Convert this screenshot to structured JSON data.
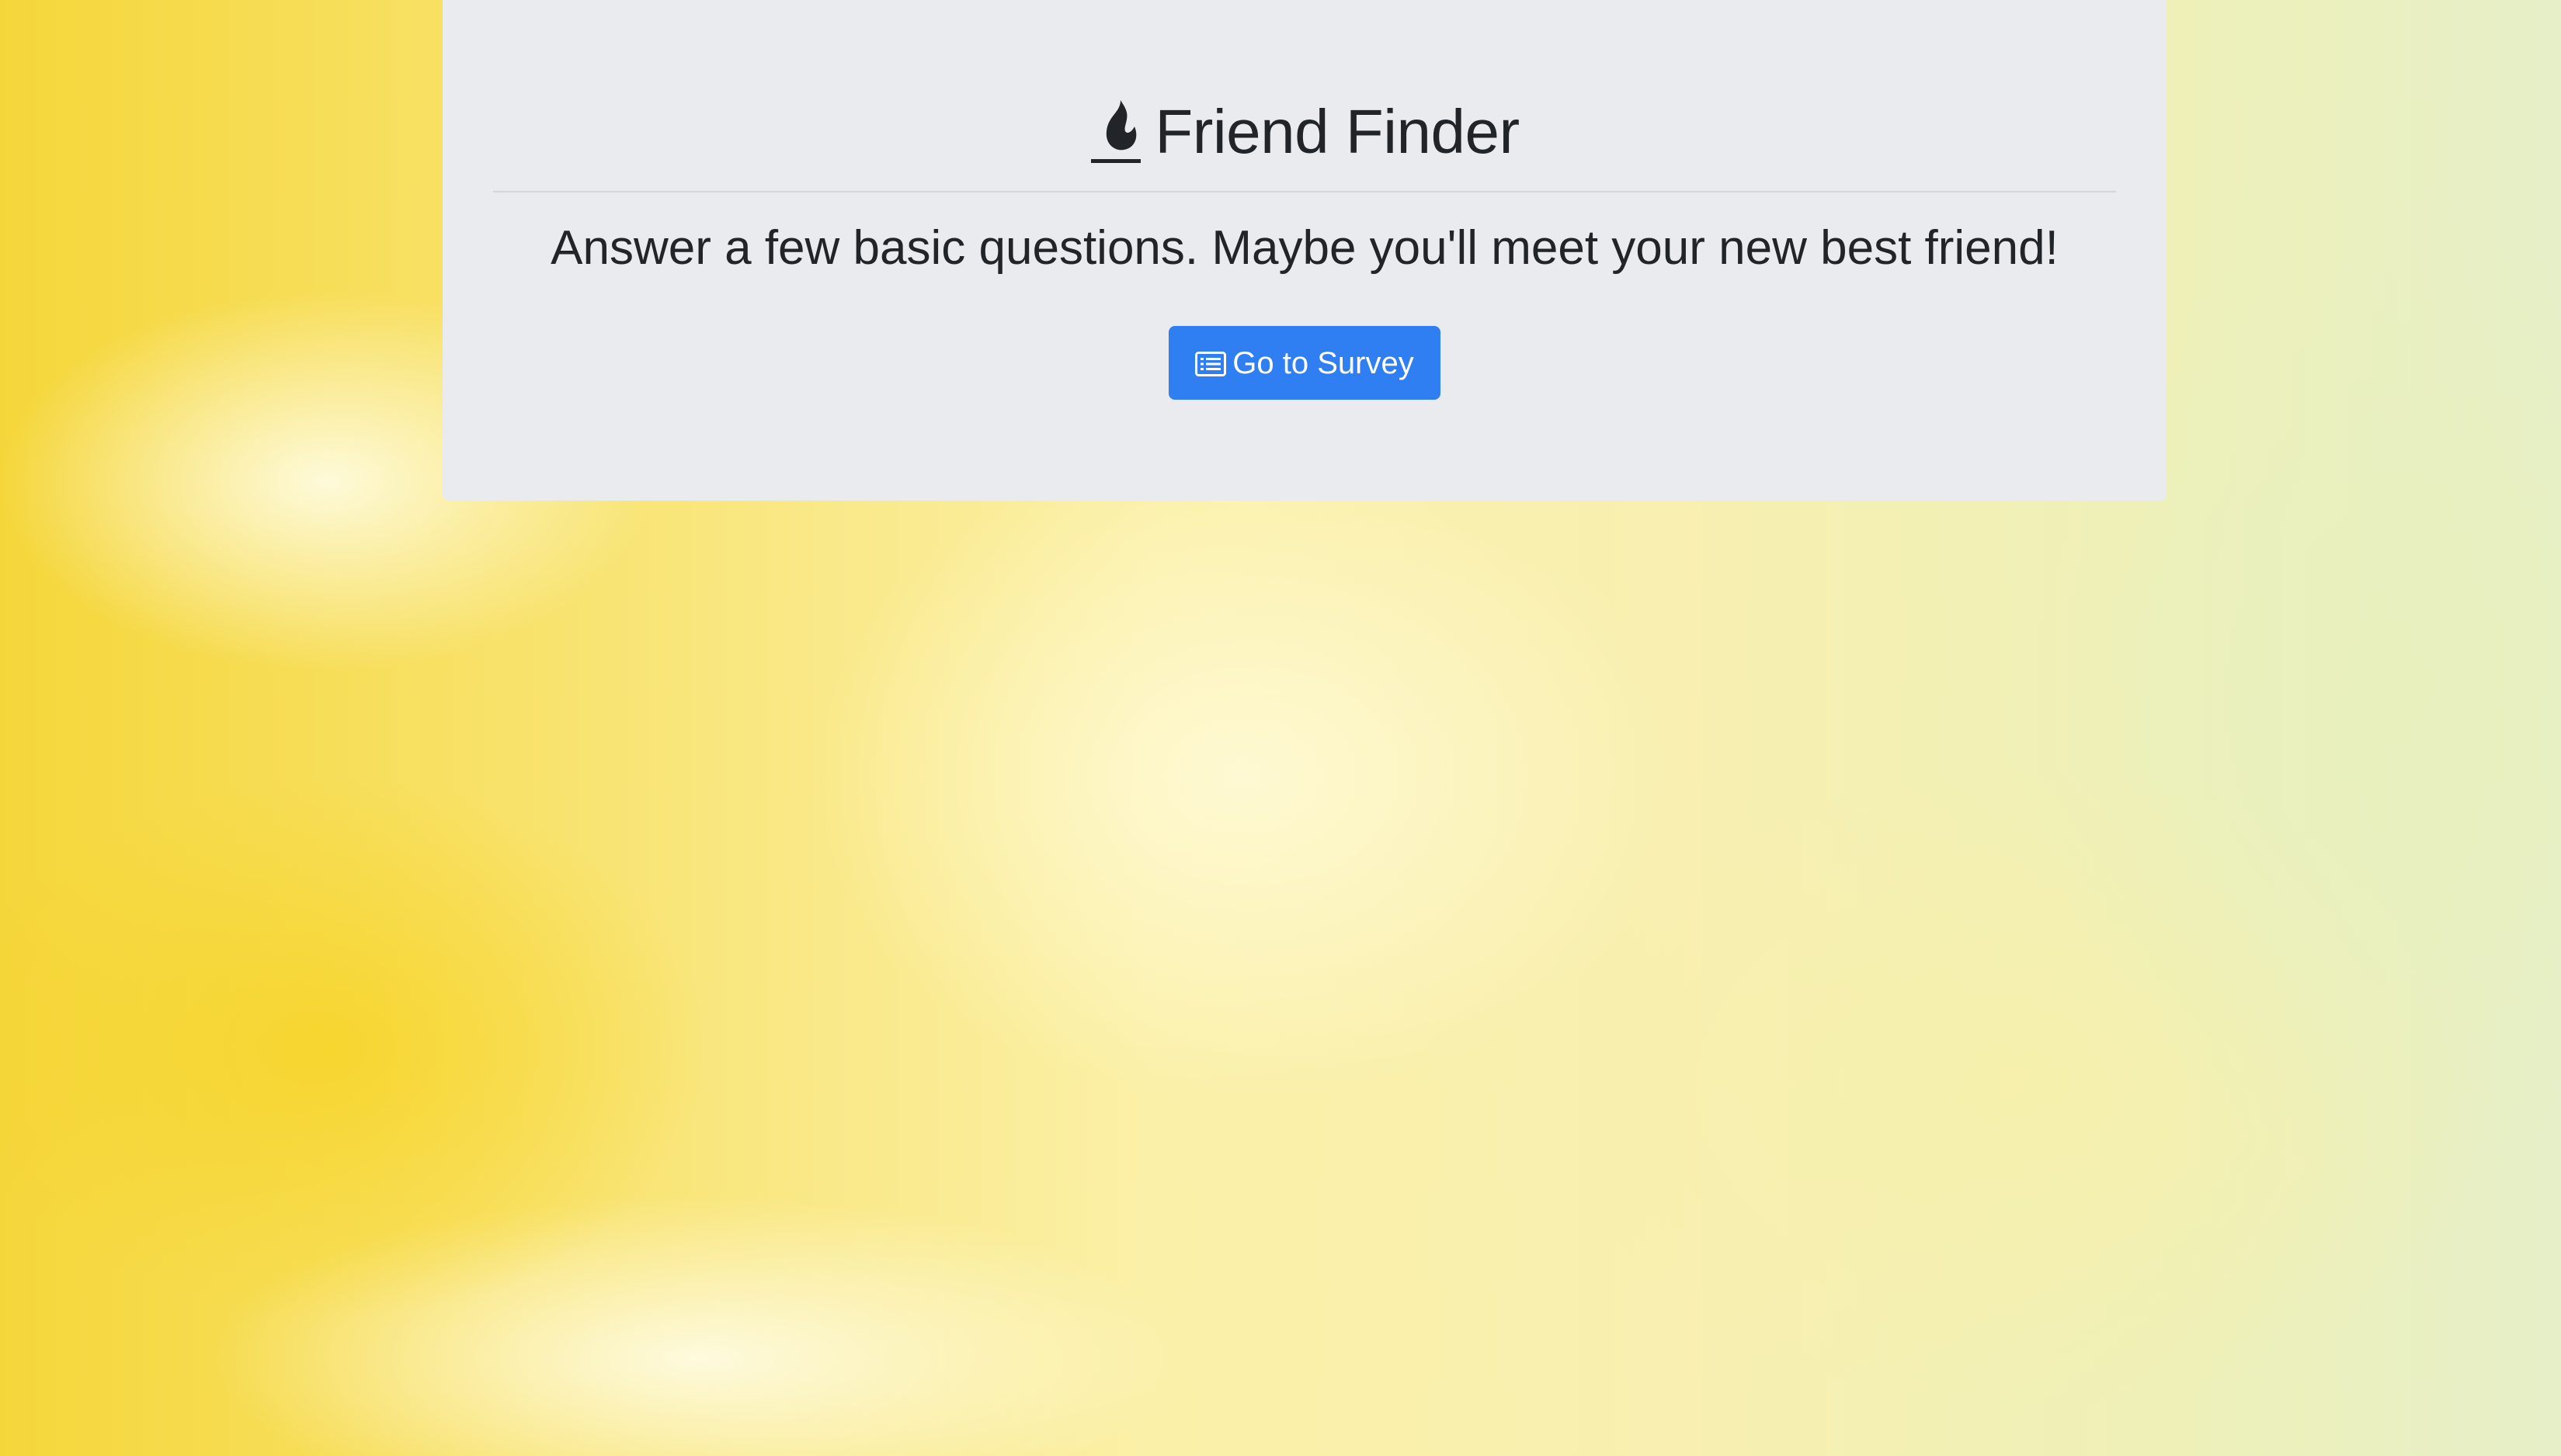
{
  "header": {
    "icon": "fire-icon",
    "title": "Friend Finder"
  },
  "main": {
    "lead": "Answer a few basic questions. Maybe you'll meet your new best friend!",
    "survey_button": {
      "icon": "list-alt-icon",
      "label": "Go to Survey"
    }
  },
  "colors": {
    "panel_background": "#e9ebef",
    "button_primary": "#2f7ff2",
    "text": "#212529",
    "page_background": "#f8e26a"
  }
}
